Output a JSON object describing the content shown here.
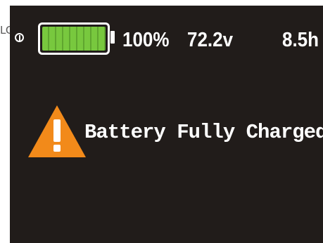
{
  "edge_label": "LCD",
  "status_bar": {
    "battery_percent_fill": 1.0,
    "percent": "100%",
    "voltage": "72.2v",
    "time": "8.5h"
  },
  "message": {
    "text": "Battery Fully Charged"
  },
  "icons": {
    "power": "power-icon",
    "battery": "battery-icon",
    "warning": "warning-icon"
  },
  "colors": {
    "screen": "#211c1a",
    "battery_fill": "#78c83e",
    "warning": "#f28a1a",
    "text": "#ffffff"
  }
}
